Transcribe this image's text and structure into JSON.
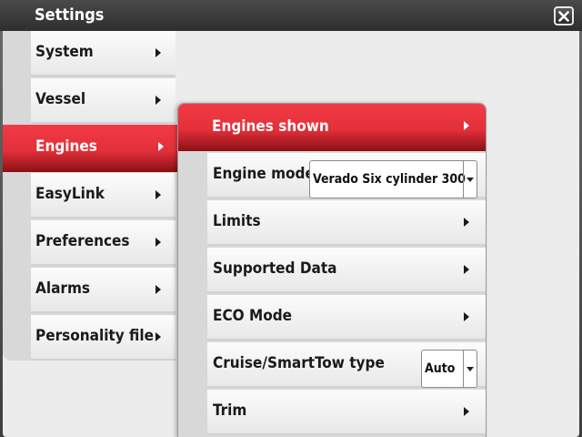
{
  "window": {
    "title": "Settings",
    "close_icon": "close-icon"
  },
  "left_menu": {
    "items": [
      {
        "label": "System"
      },
      {
        "label": "Vessel"
      },
      {
        "label": "Engines",
        "selected": true
      },
      {
        "label": "EasyLink"
      },
      {
        "label": "Preferences"
      },
      {
        "label": "Alarms"
      },
      {
        "label": "Personality file"
      }
    ]
  },
  "engines_panel": {
    "items": [
      {
        "label": "Engines shown",
        "selected": true
      },
      {
        "label": "Engine model",
        "dropdown_value": "Verado Six cylinder 300"
      },
      {
        "label": "Limits"
      },
      {
        "label": "Supported Data"
      },
      {
        "label": "ECO Mode"
      },
      {
        "label": "Cruise/SmartTow type",
        "dropdown_value": "Auto"
      },
      {
        "label": "Trim"
      }
    ]
  },
  "colors": {
    "accent_red": "#e3303a",
    "title_bar": "#3a3a3a"
  }
}
